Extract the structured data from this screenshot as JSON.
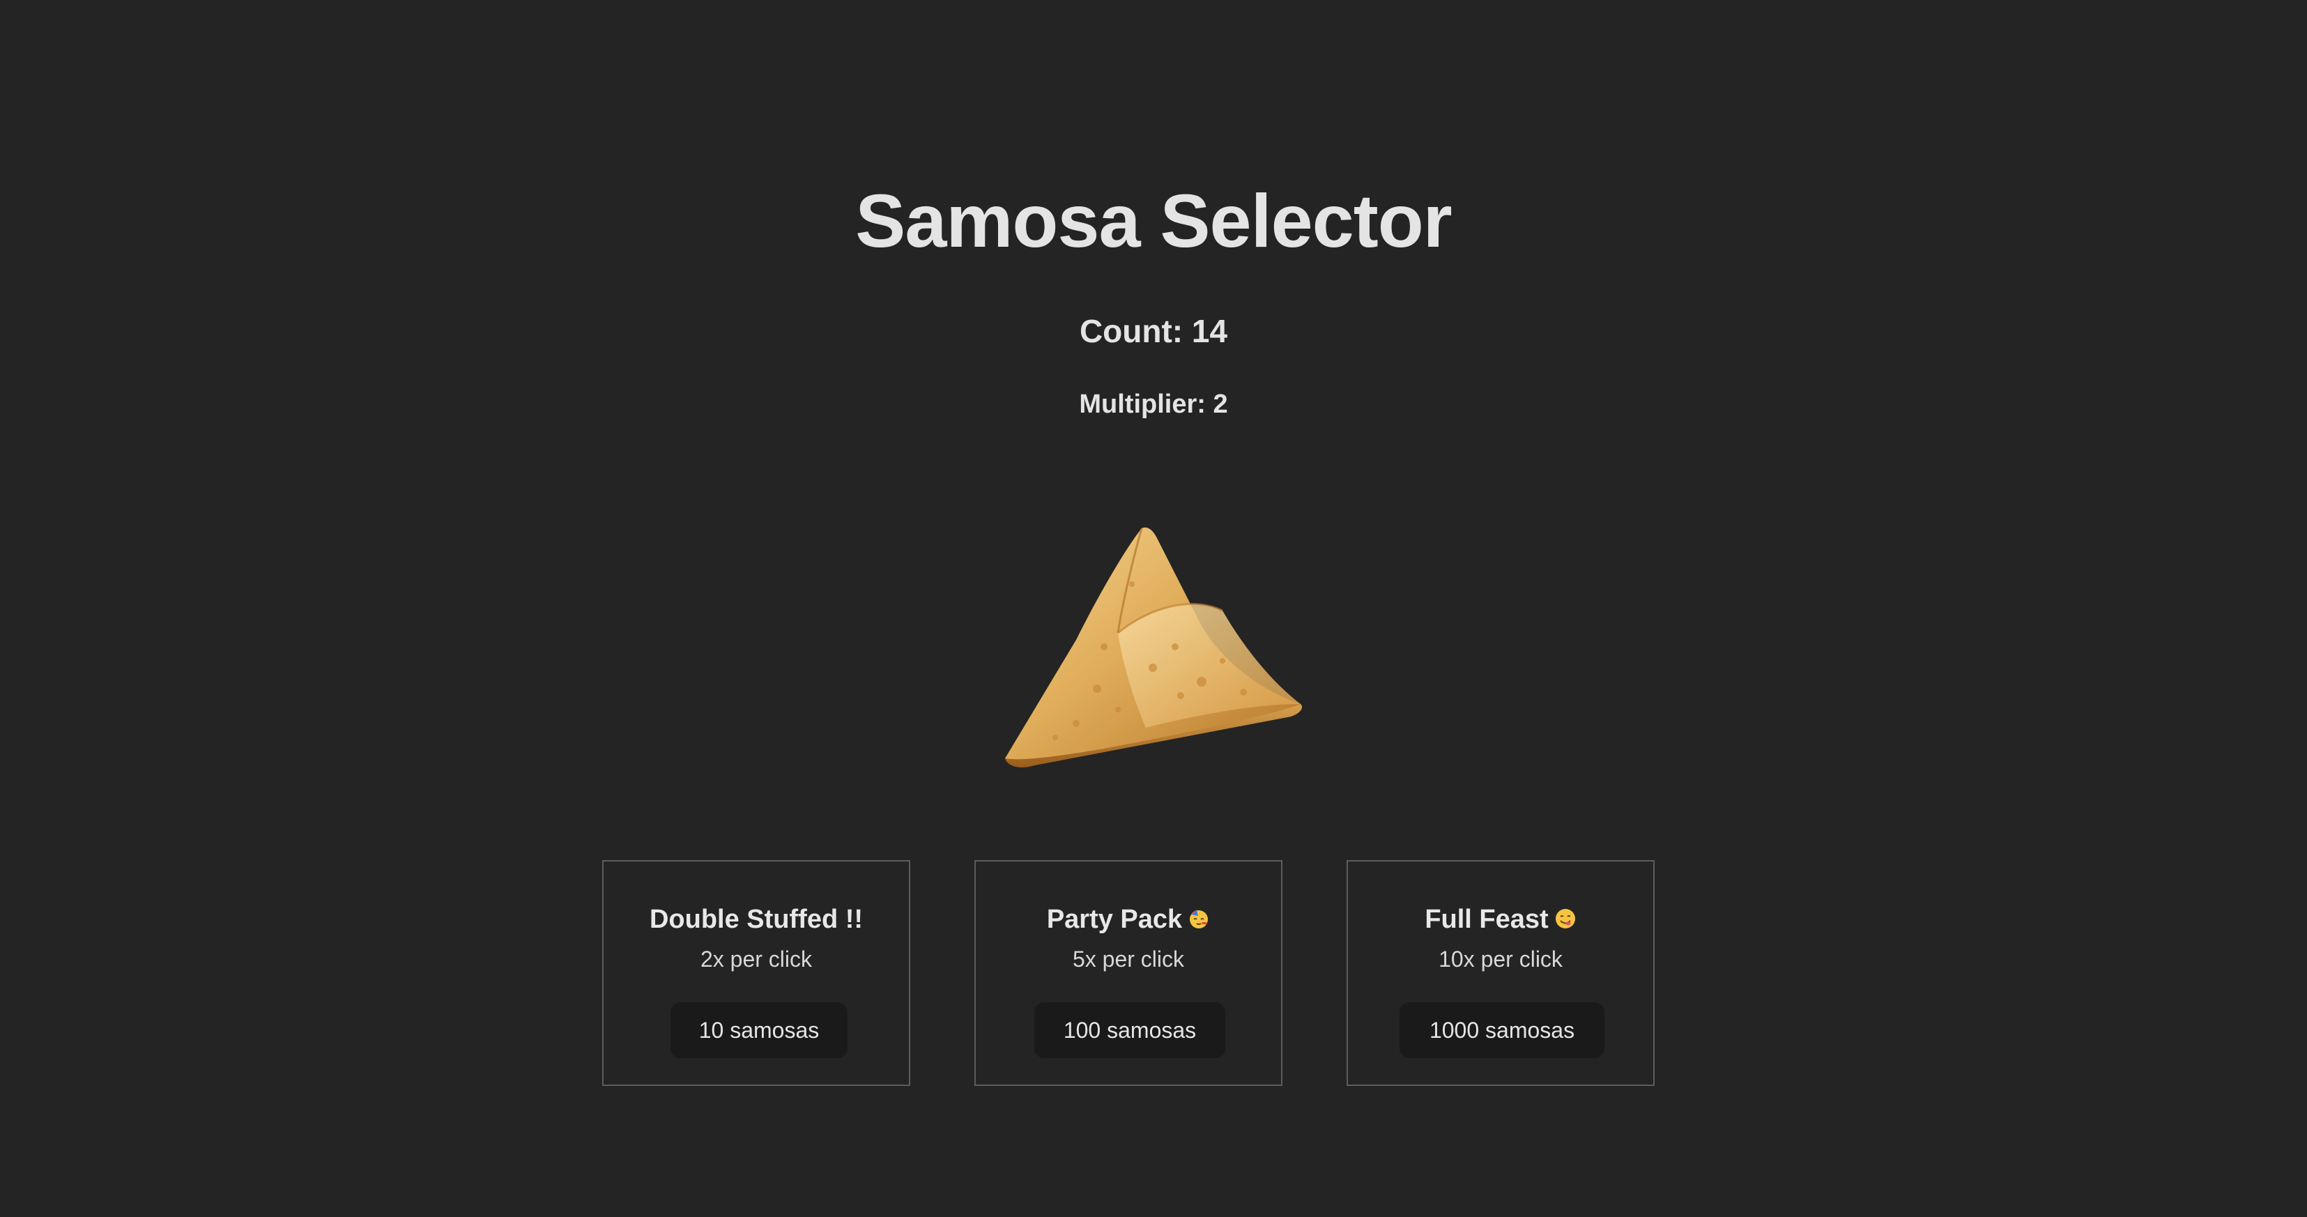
{
  "app": {
    "title": "Samosa Selector"
  },
  "stats": {
    "count_text": "Count: 14",
    "multiplier_text": "Multiplier: 2"
  },
  "samosa_image": {
    "icon": "samosa-image"
  },
  "upgrades": [
    {
      "title": "Double Stuffed !!",
      "rate": "2x per click",
      "price_label": "10 samosas"
    },
    {
      "title": "Party Pack",
      "emoji": "partying-face-icon",
      "rate": "5x per click",
      "price_label": "100 samosas"
    },
    {
      "title": "Full Feast",
      "emoji": "yum-face-icon",
      "rate": "10x per click",
      "price_label": "1000 samosas"
    }
  ],
  "colors": {
    "background": "#242424",
    "text": "#e4e4e4",
    "card_border": "#5c5c5c",
    "button_bg": "#1a1a1a"
  }
}
